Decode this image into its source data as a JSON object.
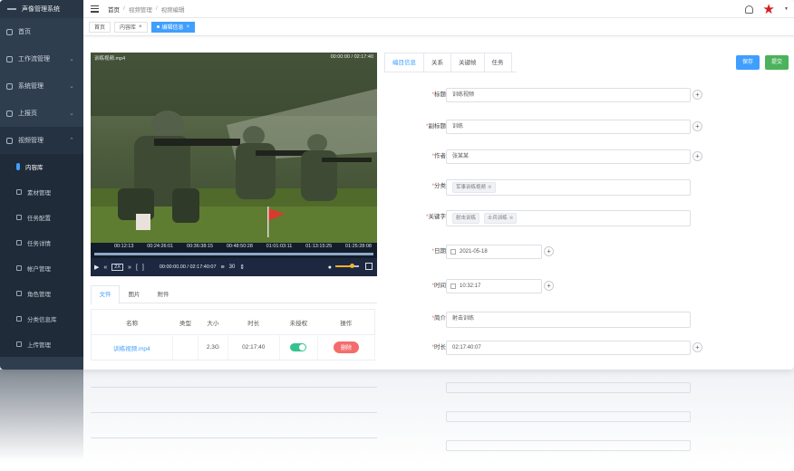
{
  "app": {
    "title": "声像管理系统"
  },
  "sidebar": {
    "items": [
      {
        "label": "首页",
        "icon": "home-icon"
      },
      {
        "label": "工作流管理",
        "icon": "workflow-icon"
      },
      {
        "label": "系统管理",
        "icon": "settings-icon"
      },
      {
        "label": "上报页",
        "icon": "upload-page-icon"
      },
      {
        "label": "视频管理",
        "icon": "video-icon"
      }
    ],
    "submenu": [
      {
        "label": "内容库",
        "active": true
      },
      {
        "label": "素材管理",
        "icon": "material-icon"
      },
      {
        "label": "任务配置",
        "icon": "task-config-icon"
      },
      {
        "label": "任务详情",
        "icon": "task-detail-icon"
      },
      {
        "label": "帐户管理",
        "icon": "account-icon"
      },
      {
        "label": "角色管理",
        "icon": "role-icon"
      },
      {
        "label": "分类信息库",
        "icon": "category-icon"
      },
      {
        "label": "上传管理",
        "icon": "upload-icon"
      }
    ]
  },
  "header": {
    "breadcrumb": [
      "首页",
      "视频管理",
      "视频编辑"
    ]
  },
  "tags": [
    {
      "label": "首页",
      "active": false
    },
    {
      "label": "内容库",
      "active": false
    },
    {
      "label": "编辑信息",
      "active": true
    }
  ],
  "video": {
    "file_name": "训练视频.mp4",
    "top_right": "00:00:00 / 02:17:40",
    "timeline_ticks": [
      "00:12:13",
      "00:24:26:01",
      "00:36:38:15",
      "00:48:50:28",
      "01:01:03:11",
      "01:13:15:25",
      "01:25:28:08"
    ],
    "progress": 0,
    "speed": "2X",
    "time_display": "00:00:00.00 / 02:17:40:07",
    "frame_label": "30",
    "volume": 0.7
  },
  "file_tabs": [
    "文件",
    "图片",
    "附件"
  ],
  "file_table": {
    "columns": [
      "名称",
      "类型",
      "大小",
      "时长",
      "未授权",
      "操作"
    ],
    "rows": [
      {
        "name": "训练视频.mp4",
        "type": "",
        "size": "2.3G",
        "duration": "02:17:40",
        "authorized": true,
        "action": "删除"
      }
    ]
  },
  "form_tabs": [
    "编目信息",
    "关系",
    "关键帧",
    "任务"
  ],
  "form_buttons": {
    "save": "保存",
    "submit": "提交"
  },
  "form": [
    {
      "label": "标题",
      "required": true,
      "value": "训练视频",
      "type": "text",
      "plus": true
    },
    {
      "label": "副标题",
      "required": true,
      "value": "训练",
      "type": "text",
      "plus": true
    },
    {
      "label": "作者",
      "required": true,
      "value": "张某某",
      "type": "text",
      "plus": true
    },
    {
      "label": "分类",
      "required": true,
      "chips": [
        "军事训练视频"
      ],
      "type": "select",
      "plus": false
    },
    {
      "label": "关键字",
      "required": true,
      "chips": [
        "射击训练",
        "士兵训练"
      ],
      "type": "select",
      "plus": false
    },
    {
      "label": "日期",
      "required": true,
      "value": "2021-05-18",
      "type": "date",
      "plus": true
    },
    {
      "label": "时间",
      "required": true,
      "value": "10:32:17",
      "type": "time",
      "plus": true
    },
    {
      "label": "简介",
      "required": true,
      "value": "射击训练",
      "type": "textarea",
      "plus": false
    },
    {
      "label": "时长",
      "required": true,
      "value": "02:17:40:07",
      "type": "text",
      "plus": true
    }
  ],
  "colors": {
    "sidebar_bg": "#2f3e4f",
    "accent": "#409eff",
    "success": "#4cb25b",
    "danger": "#f56c6c"
  }
}
